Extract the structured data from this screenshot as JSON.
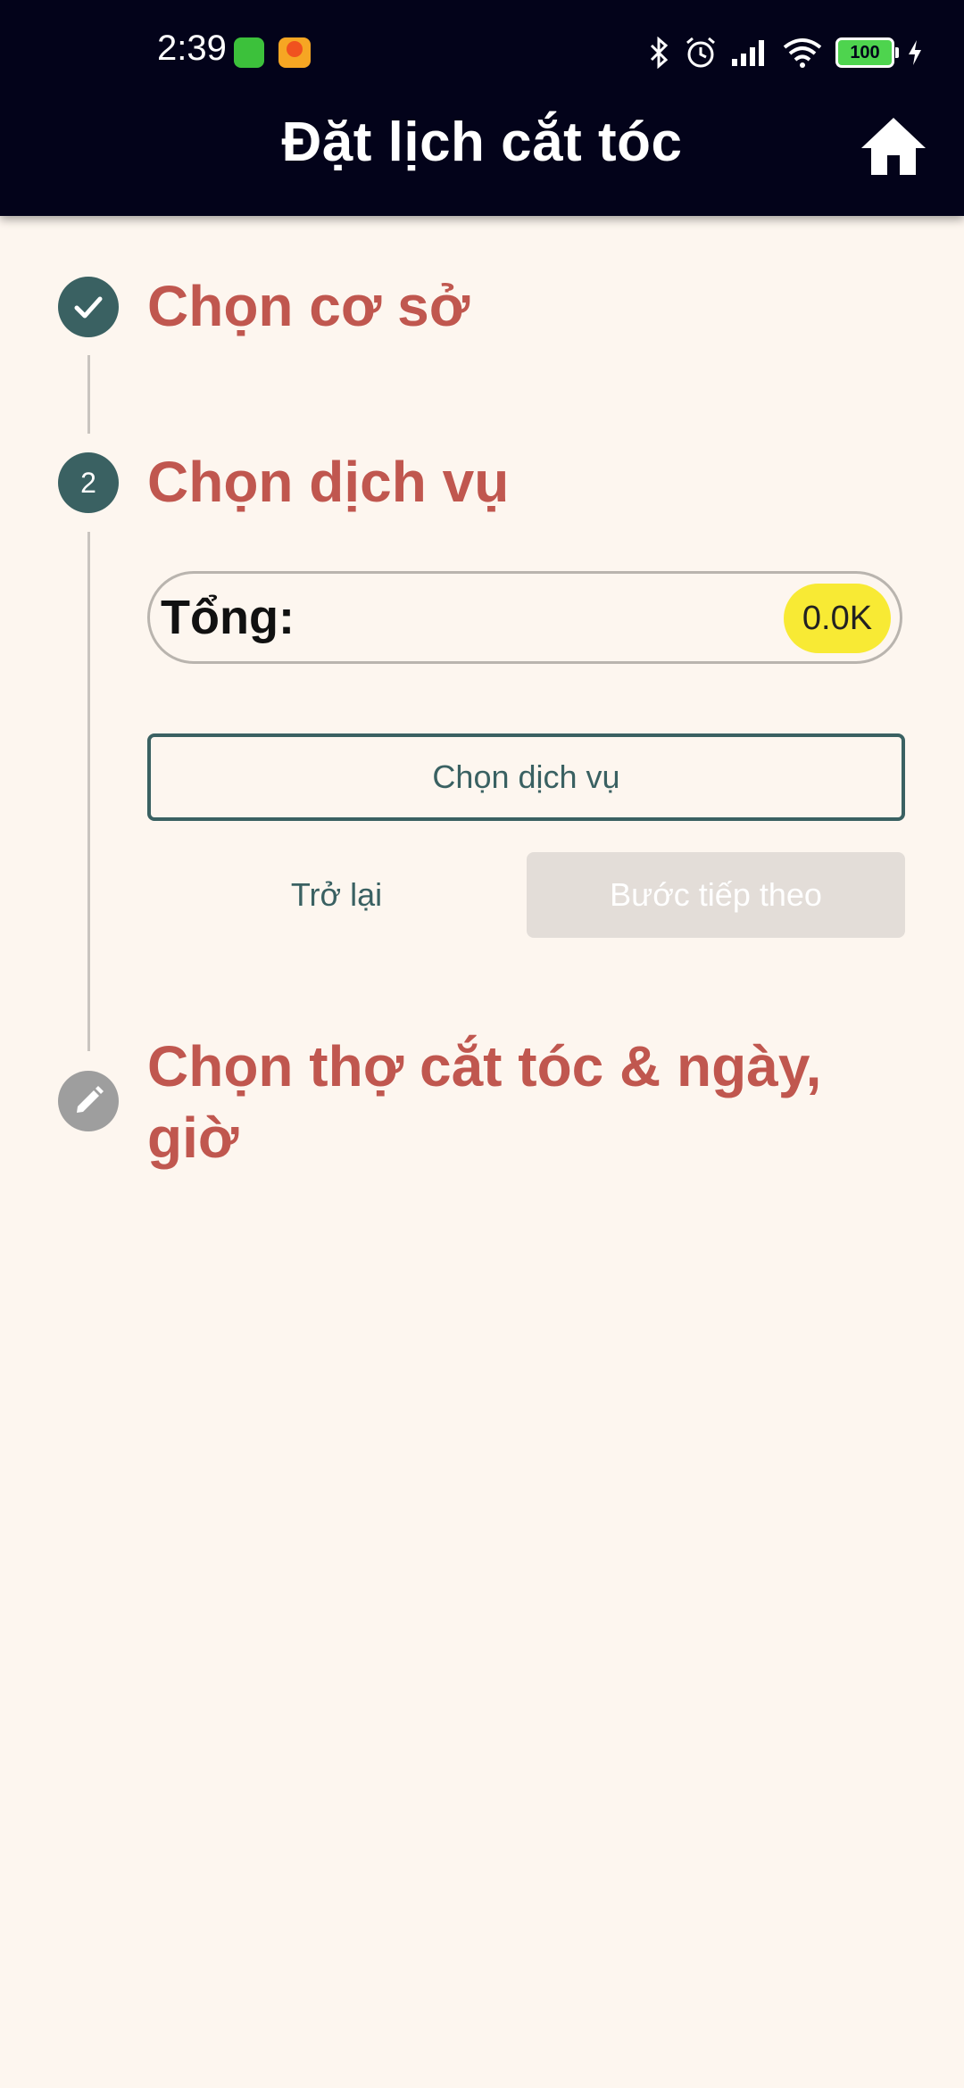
{
  "status_bar": {
    "time": "2:39",
    "battery": "100",
    "icons": [
      "bluetooth-icon",
      "alarm-icon",
      "signal-icon",
      "wifi-icon",
      "battery-icon",
      "charging-icon"
    ]
  },
  "app_bar": {
    "title": "Đặt lịch cắt tóc",
    "home_icon": "home-icon"
  },
  "steps": [
    {
      "title": "Chọn cơ sở",
      "state": "completed",
      "icon": "check-icon"
    },
    {
      "title": "Chọn dịch vụ",
      "state": "active",
      "number": "2"
    },
    {
      "title": "Chọn thợ cắt tóc & ngày, giờ",
      "state": "pending",
      "icon": "pencil-icon"
    }
  ],
  "service_step": {
    "total_label": "Tổng:",
    "total_value": "0.0K",
    "select_button": "Chọn dịch vụ",
    "back_button": "Trở lại",
    "next_button": "Bước tiếp theo"
  },
  "colors": {
    "appbar_bg": "#03031a",
    "page_bg": "#fdf6ef",
    "step_title": "#c0574f",
    "primary": "#3a6162",
    "badge": "#f8ea34",
    "disabled_bg": "#e3ddd8"
  }
}
